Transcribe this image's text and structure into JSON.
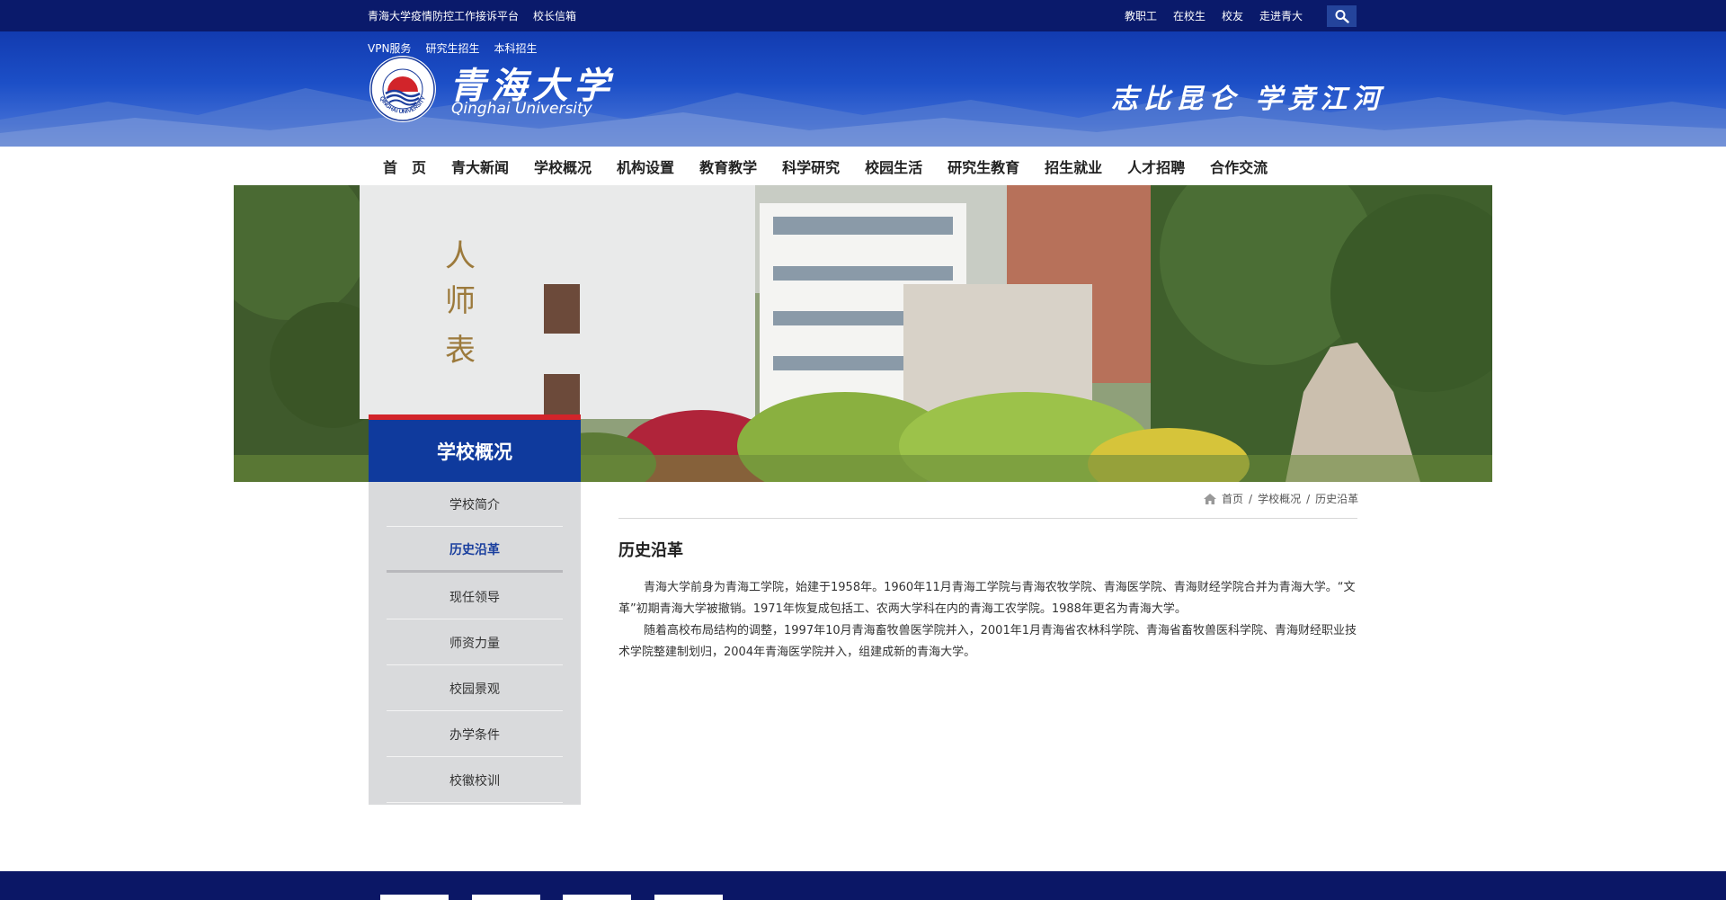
{
  "topbar": {
    "left_links": [
      "青海大学疫情防控工作接诉平台",
      "校长信箱"
    ],
    "right_links": [
      "教职工",
      "在校生",
      "校友",
      "走进青大"
    ],
    "search_icon": "search-icon"
  },
  "header": {
    "quick_links": [
      "VPN服务",
      "研究生招生",
      "本科招生"
    ],
    "logo_cn": "青海大学",
    "logo_en": "Qinghai University",
    "seal_text": "QINGHAI UNIVERSITY",
    "motto": "志比昆仑 学竞江河"
  },
  "nav": {
    "items": [
      "首　页",
      "青大新闻",
      "学校概况",
      "机构设置",
      "教育教学",
      "科学研究",
      "校园生活",
      "研究生教育",
      "招生就业",
      "人才招聘",
      "合作交流"
    ]
  },
  "sidebar": {
    "title": "学校概况",
    "items": [
      {
        "label": "学校简介",
        "active": false
      },
      {
        "label": "历史沿革",
        "active": true
      },
      {
        "label": "现任领导",
        "active": false
      },
      {
        "label": "师资力量",
        "active": false
      },
      {
        "label": "校园景观",
        "active": false
      },
      {
        "label": "办学条件",
        "active": false
      },
      {
        "label": "校徽校训",
        "active": false
      }
    ]
  },
  "breadcrumb": {
    "icon": "home-icon",
    "items": [
      "首页",
      "学校概况",
      "历史沿革"
    ],
    "separator": "/"
  },
  "content": {
    "title": "历史沿革",
    "paragraphs": [
      "青海大学前身为青海工学院，始建于1958年。1960年11月青海工学院与青海农牧学院、青海医学院、青海财经学院合并为青海大学。“文革”初期青海大学被撤销。1971年恢复成包括工、农两大学科在内的青海工农学院。1988年更名为青海大学。",
      "随着高校布局结构的调整，1997年10月青海畜牧兽医学院并入，2001年1月青海省农林科学院、青海省畜牧兽医科学院、青海财经职业技术学院整建制划归，2004年青海医学院并入，组建成新的青海大学。"
    ]
  },
  "colors": {
    "topbar": "#0a1a6b",
    "header": "#1c4fc7",
    "sidebar_head": "#0f3a9d",
    "sidebar_accent": "#d2242a",
    "sidebar_bg": "#d9dadc",
    "footer": "#0b1766"
  }
}
